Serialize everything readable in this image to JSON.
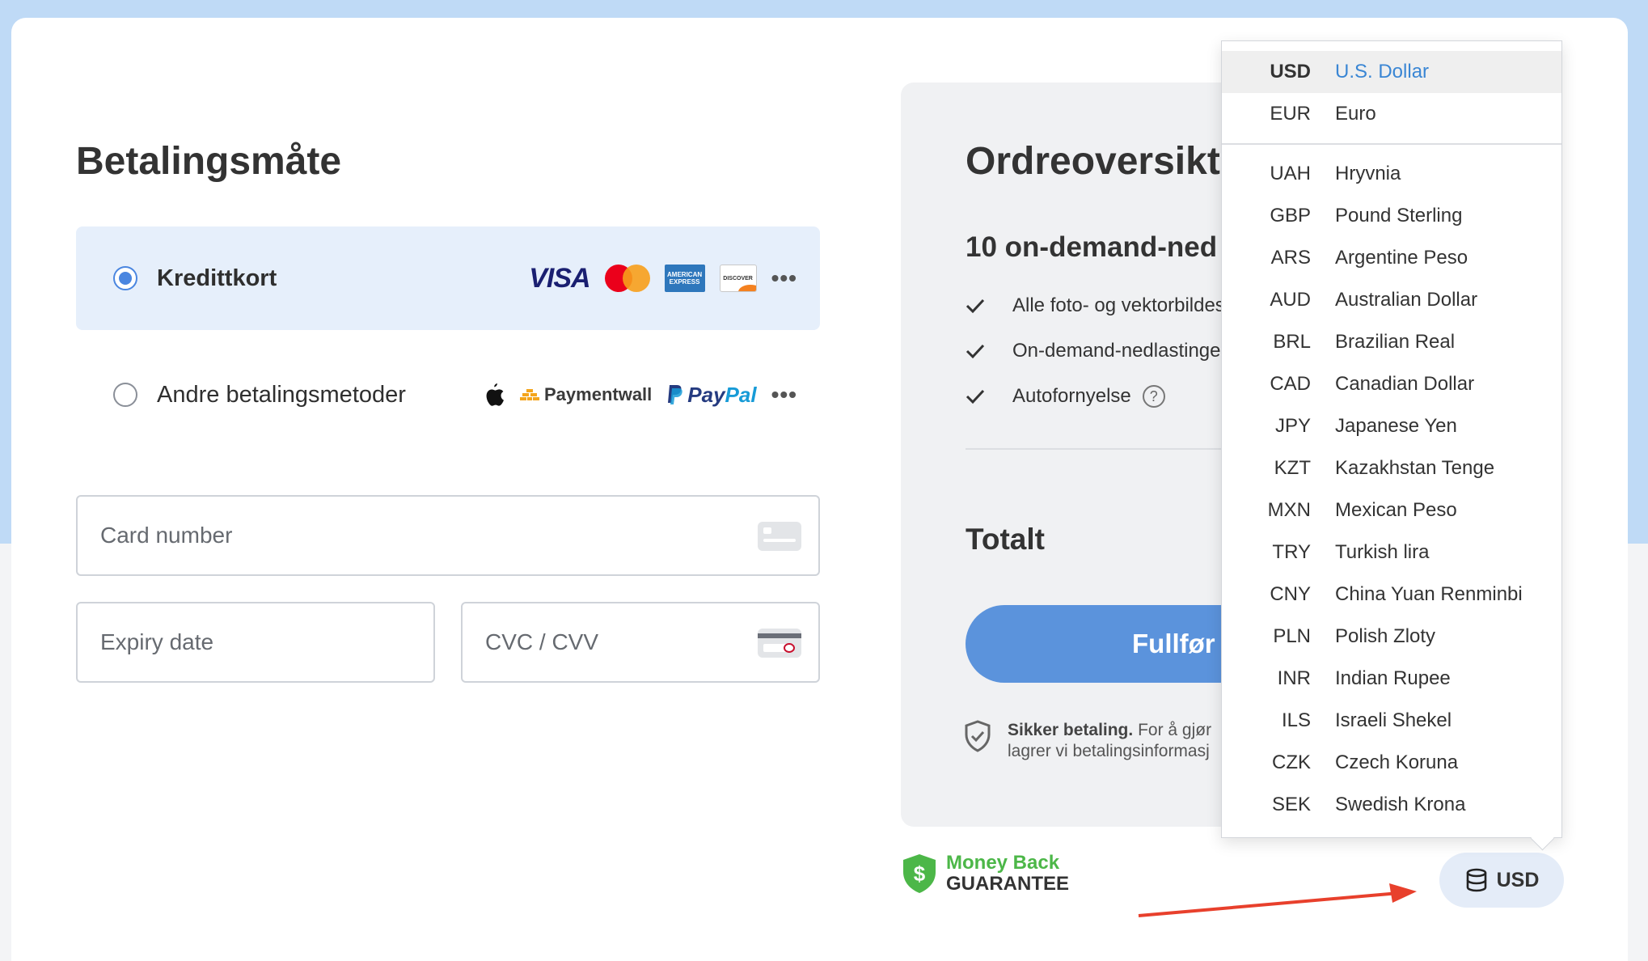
{
  "payment": {
    "title": "Betalingsmåte",
    "methods": [
      {
        "label": "Kredittkort",
        "selected": true,
        "logos": [
          "VISA",
          "mastercard-icon",
          "AMERICAN EXPRESS",
          "DISCOVER"
        ]
      },
      {
        "label": "Andre betalingsmetoder",
        "selected": false,
        "logos": [
          "apple-icon",
          "Paymentwall",
          "PayPal"
        ]
      }
    ],
    "logo_text": {
      "visa": "VISA",
      "amex": "AMERICAN EXPRESS",
      "discover": "DISCOVER",
      "paymentwall": "Paymentwall",
      "paypal_1": "Pay",
      "paypal_2": "Pal",
      "more": "•••"
    },
    "fields": {
      "card_number_placeholder": "Card number",
      "expiry_placeholder": "Expiry date",
      "cvc_placeholder": "CVC / CVV"
    }
  },
  "order": {
    "title": "Ordreoversikt",
    "plan": "10 on-demand-ned",
    "features": [
      "Alle foto- og vektorbildes",
      "On-demand-nedlastinge",
      "Autofornyelse"
    ],
    "help_mark": "?",
    "total_label": "Totalt",
    "finish_label": "Fullfør",
    "secure_bold": "Sikker betaling.",
    "secure_rest": " For å gjør",
    "secure_line2": "lagrer vi betalingsinformasj"
  },
  "guarantee": {
    "line1": "Money Back",
    "line2": "GUARANTEE"
  },
  "currency_button": {
    "label": "USD"
  },
  "currency_dropdown": {
    "items": [
      {
        "code": "USD",
        "name": "U.S. Dollar",
        "active": true
      },
      {
        "code": "EUR",
        "name": "Euro"
      },
      {
        "code": "UAH",
        "name": "Hryvnia"
      },
      {
        "code": "GBP",
        "name": "Pound Sterling"
      },
      {
        "code": "ARS",
        "name": "Argentine Peso"
      },
      {
        "code": "AUD",
        "name": "Australian Dollar"
      },
      {
        "code": "BRL",
        "name": "Brazilian Real"
      },
      {
        "code": "CAD",
        "name": "Canadian Dollar"
      },
      {
        "code": "JPY",
        "name": "Japanese Yen"
      },
      {
        "code": "KZT",
        "name": "Kazakhstan Tenge"
      },
      {
        "code": "MXN",
        "name": "Mexican Peso"
      },
      {
        "code": "TRY",
        "name": "Turkish lira"
      },
      {
        "code": "CNY",
        "name": "China Yuan Renminbi"
      },
      {
        "code": "PLN",
        "name": "Polish Zloty"
      },
      {
        "code": "INR",
        "name": "Indian Rupee"
      },
      {
        "code": "ILS",
        "name": "Israeli Shekel"
      },
      {
        "code": "CZK",
        "name": "Czech Koruna"
      },
      {
        "code": "SEK",
        "name": "Swedish Krona"
      }
    ]
  },
  "colors": {
    "accent": "#5b93dc",
    "selected_bg": "#e6effb",
    "link_blue": "#3a86d4",
    "guarantee_green": "#4cb748",
    "annotation_arrow": "#e8402c"
  }
}
